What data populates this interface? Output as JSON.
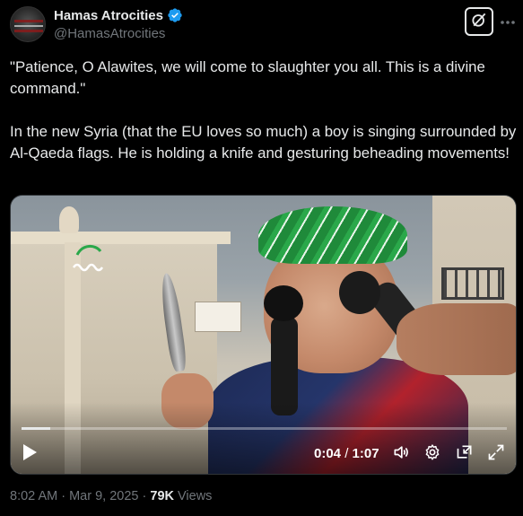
{
  "author": {
    "display_name": "Hamas Atrocities",
    "handle": "@HamasAtrocities",
    "verified": true,
    "avatar_icon": "avatar-image"
  },
  "header_actions": {
    "grok_icon": "grok-icon",
    "more_icon": "more-options-icon"
  },
  "tweet": {
    "paragraph_1": "\"Patience, O Alawites, we will come to slaughter you all. This is a divine command.\"",
    "paragraph_2": "In the new Syria (that the EU loves so much) a boy is singing surrounded by Al-Qaeda flags. He is holding a knife and gesturing beheading movements!"
  },
  "video": {
    "current_time": "0:04",
    "separator": " / ",
    "duration": "1:07",
    "progress_fraction": 0.06,
    "controls": {
      "play_icon": "play-icon",
      "volume_icon": "volume-icon",
      "settings_icon": "settings-gear-icon",
      "pip_icon": "picture-in-picture-icon",
      "fullscreen_icon": "fullscreen-icon"
    }
  },
  "meta": {
    "time": "8:02 AM",
    "dot": " · ",
    "date": "Mar 9, 2025",
    "views_count": "79K",
    "views_label": "Views"
  },
  "colors": {
    "background": "#000000",
    "text_primary": "#e7e9ea",
    "text_secondary": "#71767b",
    "verified_blue": "#1d9bf0"
  }
}
